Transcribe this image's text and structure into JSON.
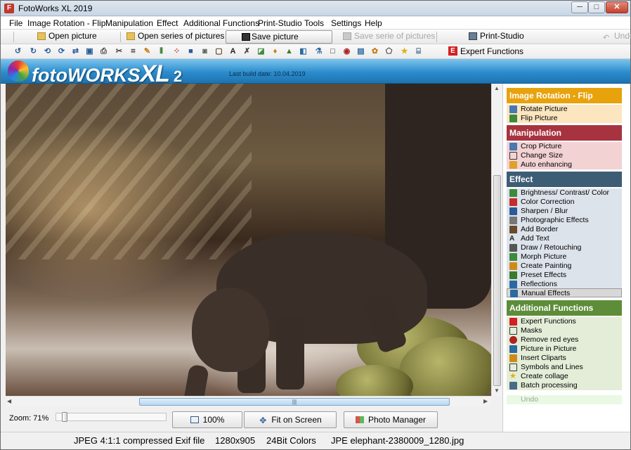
{
  "window": {
    "title": "FotoWorks XL 2019",
    "minimize": "─",
    "maximize": "□",
    "close": "✕"
  },
  "menu": [
    "File",
    "Image Rotation - Flip",
    "Manipulation",
    "Effect",
    "Additional Functions",
    "Print-Studio",
    "Tools",
    "Settings",
    "Help"
  ],
  "toolbar": {
    "open": "Open picture",
    "open_series": "Open series of pictures",
    "save": "Save picture",
    "save_series": "Save serie of pictures",
    "print": "Print-Studio",
    "undo": "Undo",
    "expert": "Expert Functions",
    "expert_letter": "E"
  },
  "banner": {
    "logo_main": "fotoWORKS",
    "logo_xl": "XL",
    "logo_version": "2",
    "build_date": "Last build date: 10.04.2019"
  },
  "bottom": {
    "zoom_label": "Zoom: 71%",
    "btn_100": "100%",
    "btn_fit": "Fit on Screen",
    "btn_photo": "Photo Manager",
    "zoom_percent": 71
  },
  "panel": {
    "sections": [
      {
        "title": "Image Rotation - Flip",
        "color": "#e8a20c",
        "item_bg": "#fbe6bf",
        "items": [
          "Rotate Picture",
          "Flip Picture"
        ]
      },
      {
        "title": "Manipulation",
        "color": "#a7333f",
        "item_bg": "#f3d2d4",
        "items": [
          "Crop Picture",
          "Change Size",
          "Auto enhancing"
        ]
      },
      {
        "title": "Effect",
        "color": "#3d5d74",
        "item_bg": "#dde3ea",
        "items": [
          "Brightness/ Contrast/ Color",
          "Color Correction",
          "Sharpen / Blur",
          "Photographic Effects",
          "Add Border",
          "Add Text",
          "Draw / Retouching",
          "Morph Picture",
          "Create Painting",
          "Preset Effects",
          "Reflections",
          "Manual Effects"
        ]
      },
      {
        "title": "Additional Functions",
        "color": "#5e8d3a",
        "item_bg": "#e3edd8",
        "items": [
          "Expert Functions",
          "Masks",
          "Remove red eyes",
          "Picture in Picture",
          "Insert Cliparts",
          "Symbols and Lines",
          "Create collage",
          "Batch processing"
        ]
      }
    ],
    "undo": "Undo"
  },
  "status": {
    "format": "JPEG 4:1:1 compressed Exif file",
    "dims": "1280x905",
    "colors": "24Bit Colors",
    "filename": "JPE elephant-2380009_1280.jpg"
  }
}
